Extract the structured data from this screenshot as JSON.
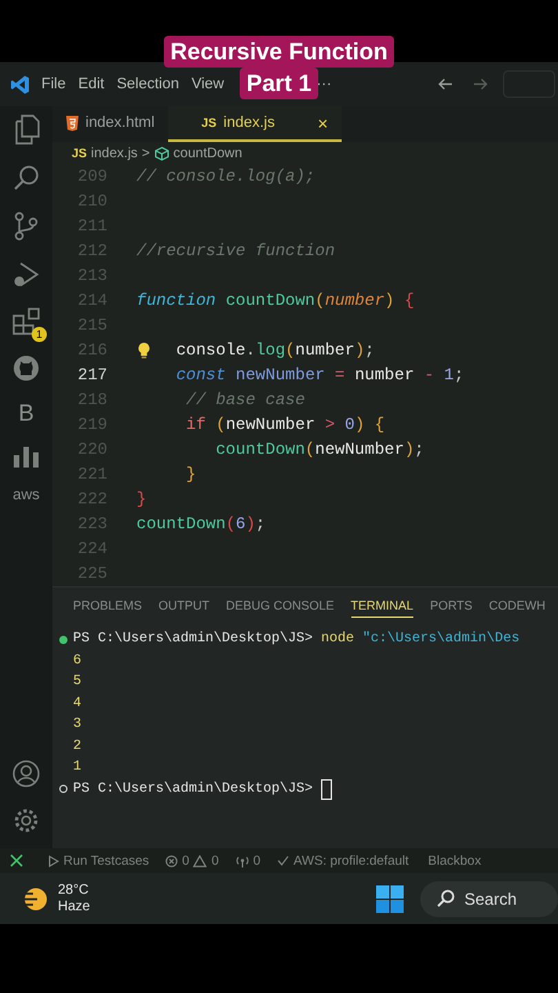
{
  "caption": {
    "lines": [
      "Recursive Function",
      "Part 1"
    ]
  },
  "menu": [
    "File",
    "Edit",
    "Selection",
    "View",
    "···"
  ],
  "activity_bar": {
    "extensions_badge": "1",
    "b_letter": "B",
    "aws_label": "aws"
  },
  "tabs": [
    {
      "label": "index.html",
      "kind": "html",
      "selected": false
    },
    {
      "label": "index.js",
      "kind": "js",
      "badge": "JS",
      "close": "×",
      "selected": true
    }
  ],
  "breadcrumb": {
    "badge": "JS",
    "file": "index.js",
    "separator": ">",
    "symbol": "countDown"
  },
  "code": {
    "lines": [
      {
        "number": "209",
        "current": false,
        "hint": false,
        "tokens": [
          {
            "kind": "comment",
            "text": "// console.log(a);"
          }
        ]
      },
      {
        "number": "210",
        "current": false,
        "hint": false
      },
      {
        "number": "211",
        "current": false,
        "hint": false
      },
      {
        "number": "212",
        "current": false,
        "hint": false,
        "tokens": [
          {
            "kind": "comment",
            "text": "//recursive function"
          }
        ]
      },
      {
        "number": "213",
        "current": false,
        "hint": false
      },
      {
        "number": "214",
        "current": false,
        "hint": false,
        "tokens": [
          {
            "kind": "storage",
            "text": "function "
          },
          {
            "kind": "function",
            "text": "countDown"
          },
          {
            "kind": "paren",
            "text": "("
          },
          {
            "kind": "param",
            "text": "number"
          },
          {
            "kind": "paren",
            "text": ") "
          },
          {
            "kind": "brace",
            "text": "{"
          }
        ]
      },
      {
        "number": "215",
        "current": false,
        "hint": false
      },
      {
        "number": "216",
        "current": false,
        "hint": true,
        "tokens": [
          {
            "kind": "plain",
            "text": "    console"
          },
          {
            "kind": "punct",
            "text": "."
          },
          {
            "kind": "method",
            "text": "log"
          },
          {
            "kind": "paren",
            "text": "("
          },
          {
            "kind": "plain",
            "text": "number"
          },
          {
            "kind": "paren",
            "text": ")"
          },
          {
            "kind": "punct",
            "text": ";"
          }
        ]
      },
      {
        "number": "217",
        "current": true,
        "hint": false,
        "tokens": [
          {
            "kind": "storage2",
            "text": "    const "
          },
          {
            "kind": "constant",
            "text": "newNumber"
          },
          {
            "kind": "operator",
            "text": " = "
          },
          {
            "kind": "plain",
            "text": "number"
          },
          {
            "kind": "operator",
            "text": " - "
          },
          {
            "kind": "number",
            "text": "1"
          },
          {
            "kind": "punct",
            "text": ";"
          }
        ]
      },
      {
        "number": "218",
        "current": false,
        "hint": false,
        "tokens": [
          {
            "kind": "comment",
            "text": "     // base case"
          }
        ]
      },
      {
        "number": "219",
        "current": false,
        "hint": false,
        "tokens": [
          {
            "kind": "control",
            "text": "     if "
          },
          {
            "kind": "paren",
            "text": "("
          },
          {
            "kind": "plain",
            "text": "newNumber"
          },
          {
            "kind": "operator",
            "text": " > "
          },
          {
            "kind": "number",
            "text": "0"
          },
          {
            "kind": "paren",
            "text": ") {"
          }
        ]
      },
      {
        "number": "220",
        "current": false,
        "hint": false,
        "tokens": [
          {
            "kind": "function",
            "text": "        countDown"
          },
          {
            "kind": "paren",
            "text": "("
          },
          {
            "kind": "plain",
            "text": "newNumber"
          },
          {
            "kind": "paren",
            "text": ")"
          },
          {
            "kind": "punct",
            "text": ";"
          }
        ]
      },
      {
        "number": "221",
        "current": false,
        "hint": false,
        "tokens": [
          {
            "kind": "paren",
            "text": "     }"
          }
        ]
      },
      {
        "number": "222",
        "current": false,
        "hint": false,
        "tokens": [
          {
            "kind": "brace",
            "text": "}"
          }
        ]
      },
      {
        "number": "223",
        "current": false,
        "hint": false,
        "tokens": [
          {
            "kind": "function",
            "text": "countDown"
          },
          {
            "kind": "brace",
            "text": "("
          },
          {
            "kind": "number",
            "text": "6"
          },
          {
            "kind": "brace",
            "text": ")"
          },
          {
            "kind": "punct",
            "text": ";"
          }
        ]
      },
      {
        "number": "224",
        "current": false,
        "hint": false
      },
      {
        "number": "225",
        "current": false,
        "hint": false
      }
    ]
  },
  "panel_tabs": [
    {
      "label": "PROBLEMS",
      "selected": false
    },
    {
      "label": "OUTPUT",
      "selected": false
    },
    {
      "label": "DEBUG CONSOLE",
      "selected": false
    },
    {
      "label": "TERMINAL",
      "selected": true
    },
    {
      "label": "PORTS",
      "selected": false
    },
    {
      "label": "CODEWH",
      "selected": false
    }
  ],
  "terminal": [
    {
      "kind": "prompt",
      "succeeded": true,
      "prompt": "PS C:\\Users\\admin\\Desktop\\JS>",
      "command": "node",
      "argument": "\"c:\\Users\\admin\\Des"
    },
    {
      "kind": "output",
      "text": "6"
    },
    {
      "kind": "output",
      "text": "5"
    },
    {
      "kind": "output",
      "text": "4"
    },
    {
      "kind": "output",
      "text": "3"
    },
    {
      "kind": "output",
      "text": "2"
    },
    {
      "kind": "output",
      "text": "1"
    },
    {
      "kind": "prompt",
      "succeeded": false,
      "prompt": "PS C:\\Users\\admin\\Desktop\\JS>"
    }
  ],
  "status_bar": {
    "run": "Run Testcases",
    "errors": "0",
    "warnings": "0",
    "ports": "0",
    "aws": "AWS: profile:default",
    "blackbox": "Blackbox"
  },
  "taskbar": {
    "temperature": "28°C",
    "weather": "Haze",
    "search": "Search"
  }
}
